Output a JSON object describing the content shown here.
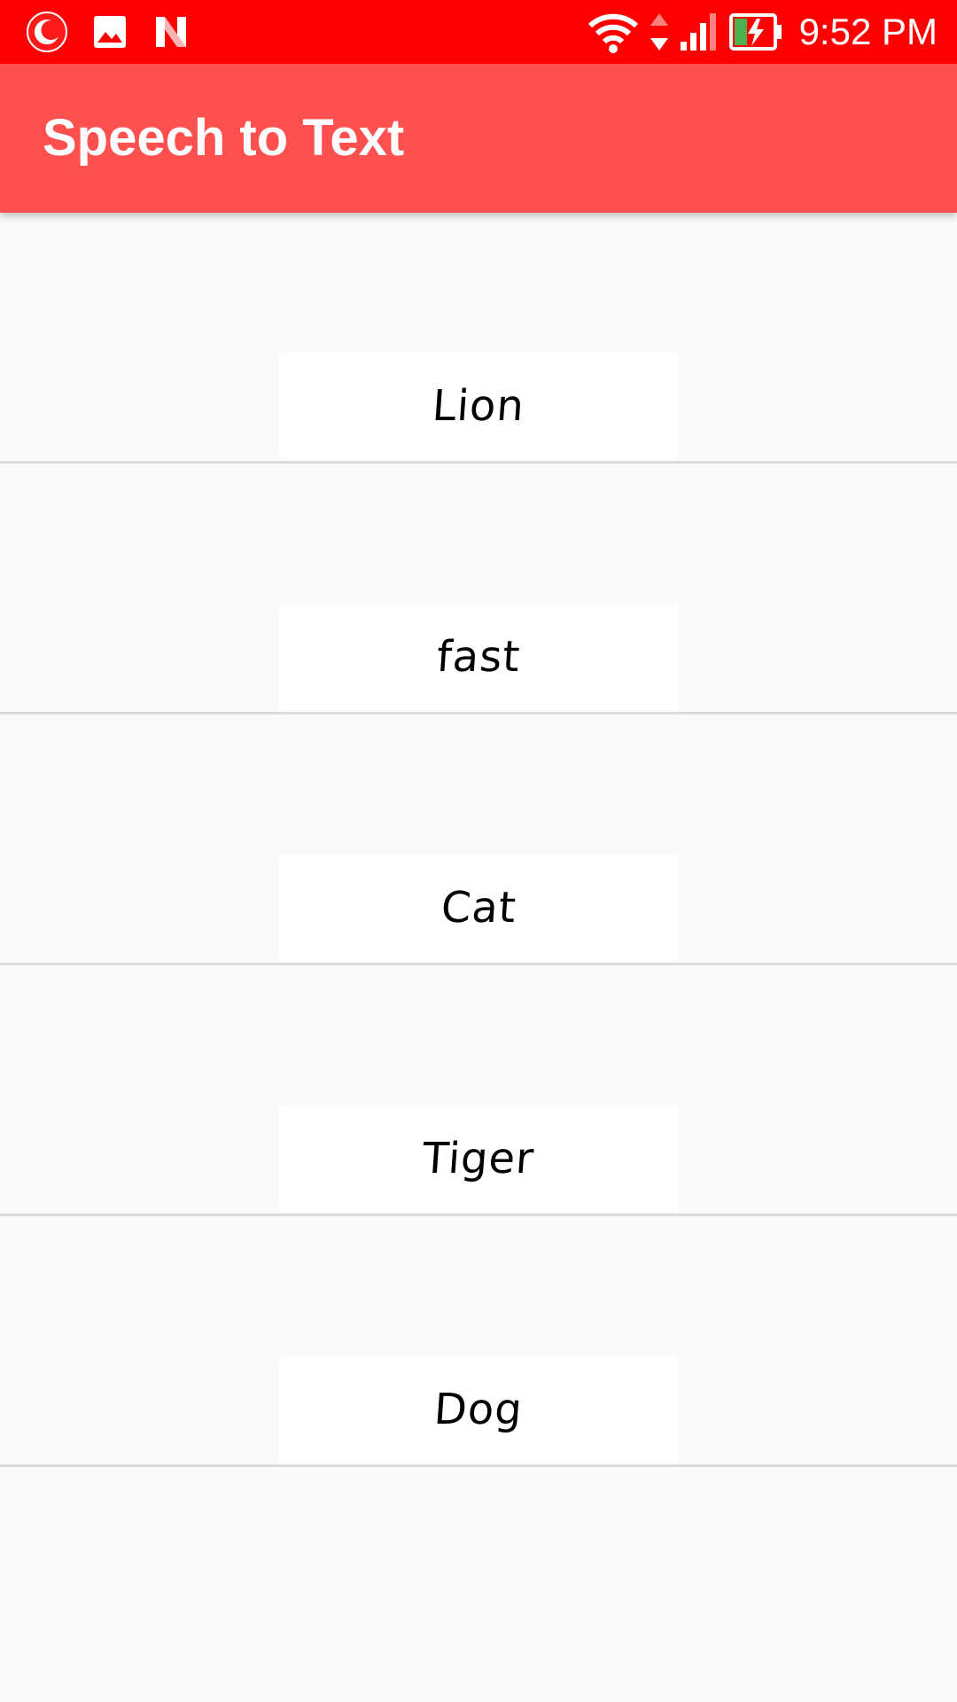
{
  "status_bar": {
    "time": "9:52 PM",
    "left_icons": [
      "moon-notification-icon",
      "image-icon",
      "n-logo-icon"
    ],
    "right_icons": [
      "wifi-icon",
      "data-arrows-icon",
      "cell-signal-icon",
      "battery-charging-icon"
    ],
    "background_color": "#ff0000"
  },
  "app_bar": {
    "title": "Speech to Text",
    "background_color": "#ff5050"
  },
  "list": {
    "items": [
      {
        "text": "Lion"
      },
      {
        "text": "fast"
      },
      {
        "text": "Cat"
      },
      {
        "text": "Tiger"
      },
      {
        "text": "Dog"
      }
    ]
  }
}
